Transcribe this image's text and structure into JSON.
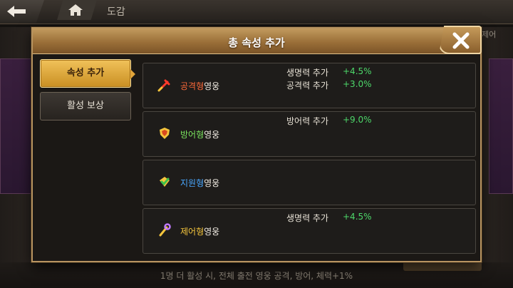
{
  "background": {
    "screen_title": "도감",
    "right_tab_label": "제어",
    "footer_text": "1명 더 활성 시, 전체 출전 영웅 공격, 방어, 체력+1%"
  },
  "dialog": {
    "title": "총 속성 추가",
    "tabs": [
      {
        "label": "속성 추가",
        "active": true
      },
      {
        "label": "활성 보상",
        "active": false
      }
    ],
    "heroes": [
      {
        "type": "공격형",
        "suffix": "영웅",
        "color": "#ff6a3a",
        "icon": "sword-icon",
        "stats": [
          {
            "name": "생명력 추가",
            "value": "+4.5%"
          },
          {
            "name": "공격력 추가",
            "value": "+3.0%"
          }
        ]
      },
      {
        "type": "방어형",
        "suffix": "영웅",
        "color": "#7be35f",
        "icon": "shield-icon",
        "stats": [
          {
            "name": "방어력 추가",
            "value": "+9.0%"
          }
        ]
      },
      {
        "type": "지원형",
        "suffix": "영웅",
        "color": "#4aa8ff",
        "icon": "heal-icon",
        "stats": []
      },
      {
        "type": "제어형",
        "suffix": "영웅",
        "color": "#f4c53c",
        "icon": "staff-icon",
        "stats": [
          {
            "name": "생명력 추가",
            "value": "+4.5%"
          }
        ]
      }
    ]
  }
}
